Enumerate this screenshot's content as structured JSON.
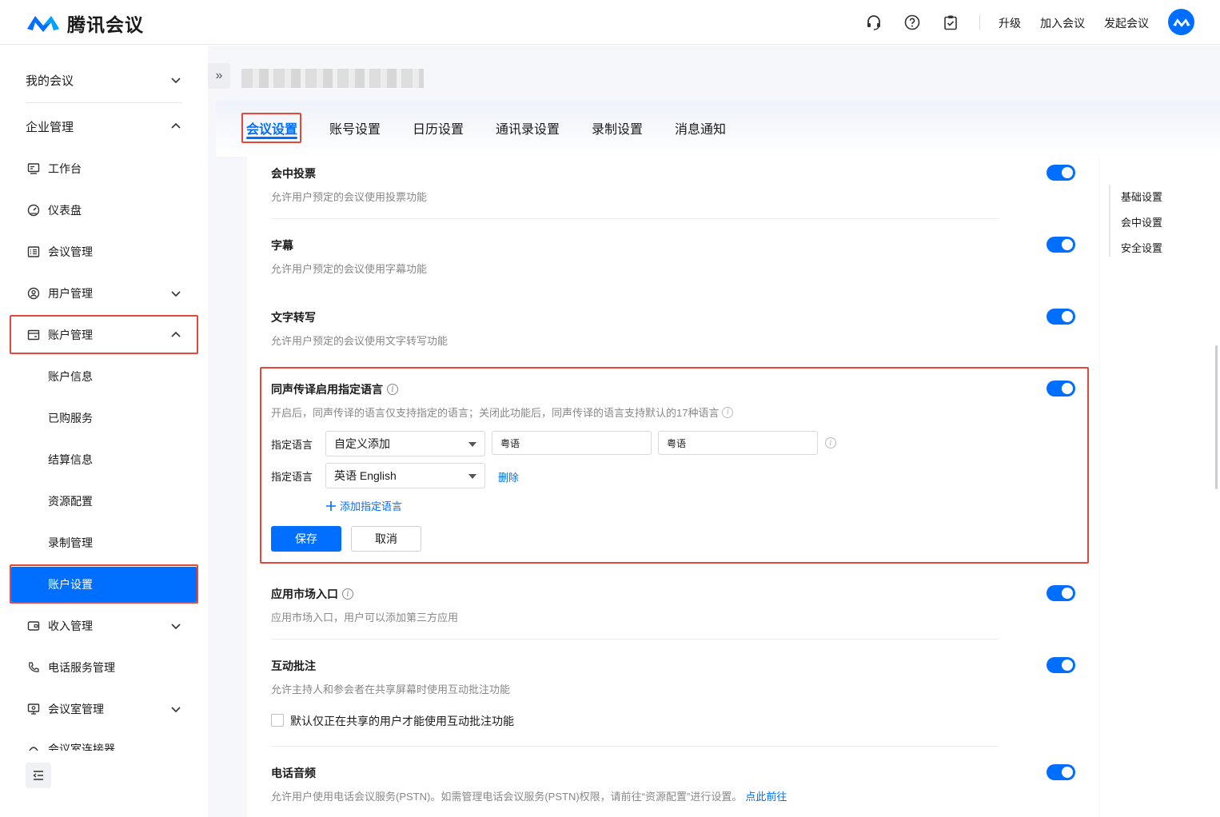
{
  "app": {
    "title": "腾讯会议",
    "brand_color": "#006eff",
    "highlight_color": "#e5473a"
  },
  "header": {
    "icons": [
      "headset-icon",
      "help-icon",
      "clipboard-check-icon"
    ],
    "links": {
      "upgrade": "升级",
      "join": "加入会议",
      "start": "发起会议"
    }
  },
  "sidebar": {
    "my_meetings": "我的会议",
    "enterprise": "企业管理",
    "items": [
      {
        "label": "工作台",
        "icon": "workbench-icon"
      },
      {
        "label": "仪表盘",
        "icon": "dashboard-icon"
      },
      {
        "label": "会议管理",
        "icon": "list-icon"
      },
      {
        "label": "用户管理",
        "icon": "user-icon"
      },
      {
        "label": "账户管理",
        "icon": "account-icon"
      },
      {
        "label": "账户信息"
      },
      {
        "label": "已购服务"
      },
      {
        "label": "结算信息"
      },
      {
        "label": "资源配置"
      },
      {
        "label": "录制管理"
      },
      {
        "label": "账户设置"
      },
      {
        "label": "收入管理",
        "icon": "wallet-icon"
      },
      {
        "label": "电话服务管理",
        "icon": "phone-icon"
      },
      {
        "label": "会议室管理",
        "icon": "room-icon"
      },
      {
        "label": "会议室连接器",
        "icon": "connector-icon"
      }
    ]
  },
  "tabs": [
    "会议设置",
    "账号设置",
    "日历设置",
    "通讯录设置",
    "录制设置",
    "消息通知"
  ],
  "right_nav": [
    "基础设置",
    "会中设置",
    "安全设置"
  ],
  "settings": {
    "vote": {
      "title": "会中投票",
      "desc": "允许用户预定的会议使用投票功能",
      "enabled": true
    },
    "caption": {
      "title": "字幕",
      "desc": "允许用户预定的会议使用字幕功能",
      "enabled": true
    },
    "transcript": {
      "title": "文字转写",
      "desc": "允许用户预定的会议使用文字转写功能",
      "enabled": true
    },
    "interpretation": {
      "title": "同声传译启用指定语言",
      "desc": "开启后，同声传译的语言仅支持指定的语言；关闭此功能后，同声传译的语言支持默认的17种语言",
      "enabled": true,
      "row1_label": "指定语言",
      "row1_select": "自定义添加",
      "row1_input_a": "粤语",
      "row1_input_b": "粤语",
      "row2_label": "指定语言",
      "row2_select": "英语 English",
      "delete": "删除",
      "add": "添加指定语言",
      "save": "保存",
      "cancel": "取消"
    },
    "app_market": {
      "title": "应用市场入口",
      "desc": "应用市场入口，用户可以添加第三方应用",
      "enabled": true
    },
    "annotation": {
      "title": "互动批注",
      "desc": "允许主持人和参会者在共享屏幕时使用互动批注功能",
      "enabled": true,
      "checkbox": "默认仅正在共享的用户才能使用互动批注功能",
      "checked": false
    },
    "pstn": {
      "title": "电话音频",
      "desc": "允许用户使用电话会议服务(PSTN)。如需管理电话会议服务(PSTN)权限，请前往“资源配置”进行设置。",
      "link": "点此前往",
      "enabled": true
    }
  }
}
